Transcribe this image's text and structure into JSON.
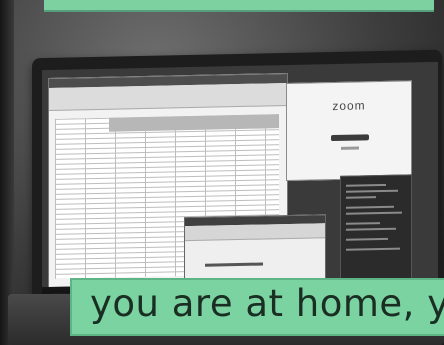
{
  "zoom_window": {
    "logo_text": "zoom"
  },
  "caption": {
    "text": "you are at home, yo"
  },
  "colors": {
    "banner": "#7ad3a0",
    "caption_text": "#1b2e24"
  }
}
